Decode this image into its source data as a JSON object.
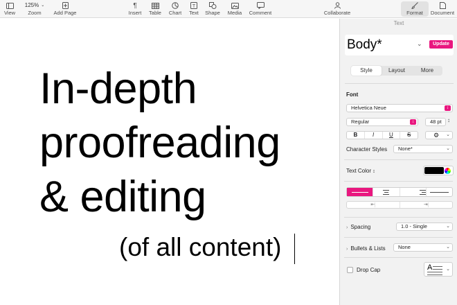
{
  "toolbar": {
    "view": "View",
    "zoom_value": "125%",
    "zoom": "Zoom",
    "add_page": "Add Page",
    "insert": "Insert",
    "table": "Table",
    "chart": "Chart",
    "text": "Text",
    "shape": "Shape",
    "media": "Media",
    "comment": "Comment",
    "collaborate": "Collaborate",
    "format": "Format",
    "document": "Document"
  },
  "canvas": {
    "heading_lines": [
      "In-depth",
      "proofreading",
      "& editing"
    ],
    "subtext": "(of all content)"
  },
  "sidebar": {
    "title": "Text",
    "style_name": "Body*",
    "update_label": "Update",
    "tabs": [
      {
        "label": "Style",
        "active": true
      },
      {
        "label": "Layout",
        "active": false
      },
      {
        "label": "More",
        "active": false
      }
    ],
    "font_label": "Font",
    "font_family": "Helvetica Neue",
    "font_weight": "Regular",
    "font_size": "48 pt",
    "format_buttons": [
      "B",
      "I",
      "U",
      "S"
    ],
    "char_styles_label": "Character Styles",
    "char_styles_value": "None*",
    "text_color_label": "Text Color",
    "text_color": "#000000",
    "accent": "#e9177f",
    "spacing_label": "Spacing",
    "spacing_value": "1.0 - Single",
    "bullets_label": "Bullets & Lists",
    "bullets_value": "None",
    "dropcap_label": "Drop Cap"
  }
}
